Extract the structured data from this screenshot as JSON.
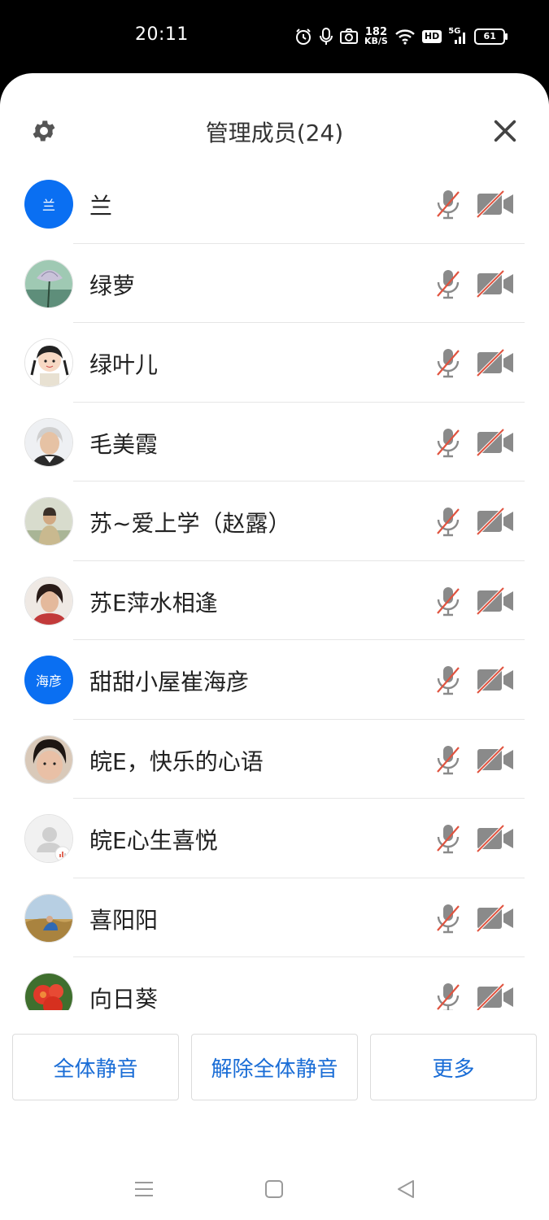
{
  "status_bar": {
    "time": "20:11",
    "speed_value": "182",
    "speed_unit": "KB/S",
    "hd_label": "HD",
    "network_label": "5G",
    "battery": "61",
    "icons": [
      "alarm-icon",
      "mic-icon",
      "camera-icon",
      "wifi-icon",
      "hd-icon",
      "signal-icon",
      "battery-icon"
    ]
  },
  "header": {
    "title": "管理成员(24)",
    "settings_icon": "gear-icon",
    "close_icon": "close-icon"
  },
  "members": [
    {
      "name": "兰",
      "avatar_text": "兰",
      "avatar_type": "text"
    },
    {
      "name": "绿萝",
      "avatar_type": "photo",
      "avatar_desc": "lotus-flower"
    },
    {
      "name": "绿叶儿",
      "avatar_type": "photo",
      "avatar_desc": "cartoon-girl"
    },
    {
      "name": "毛美霞",
      "avatar_type": "photo",
      "avatar_desc": "portrait-elderly"
    },
    {
      "name": "苏~爱上学（赵露）",
      "avatar_type": "photo",
      "avatar_desc": "portrait-outdoor"
    },
    {
      "name": "苏E萍水相逢",
      "avatar_type": "photo",
      "avatar_desc": "portrait-woman"
    },
    {
      "name": "甜甜小屋崔海彦",
      "avatar_text": "海彦",
      "avatar_type": "text"
    },
    {
      "name": "皖E，快乐的心语",
      "avatar_type": "photo",
      "avatar_desc": "portrait-face"
    },
    {
      "name": "皖E心生喜悦",
      "avatar_type": "default",
      "avatar_desc": "default-user"
    },
    {
      "name": "喜阳阳",
      "avatar_type": "photo",
      "avatar_desc": "person-field"
    },
    {
      "name": "向日葵",
      "avatar_type": "photo",
      "avatar_desc": "red-flower"
    }
  ],
  "member_status": {
    "mic": "muted",
    "camera": "off"
  },
  "actions": {
    "mute_all": "全体静音",
    "unmute_all": "解除全体静音",
    "more": "更多"
  },
  "nav": [
    "menu-icon",
    "home-icon",
    "back-icon"
  ],
  "colors": {
    "accent": "#1a6dd6",
    "avatar_blue": "#0a6ff2",
    "muted_slash": "#e0533f",
    "icon_gray": "#8a8a8a"
  }
}
